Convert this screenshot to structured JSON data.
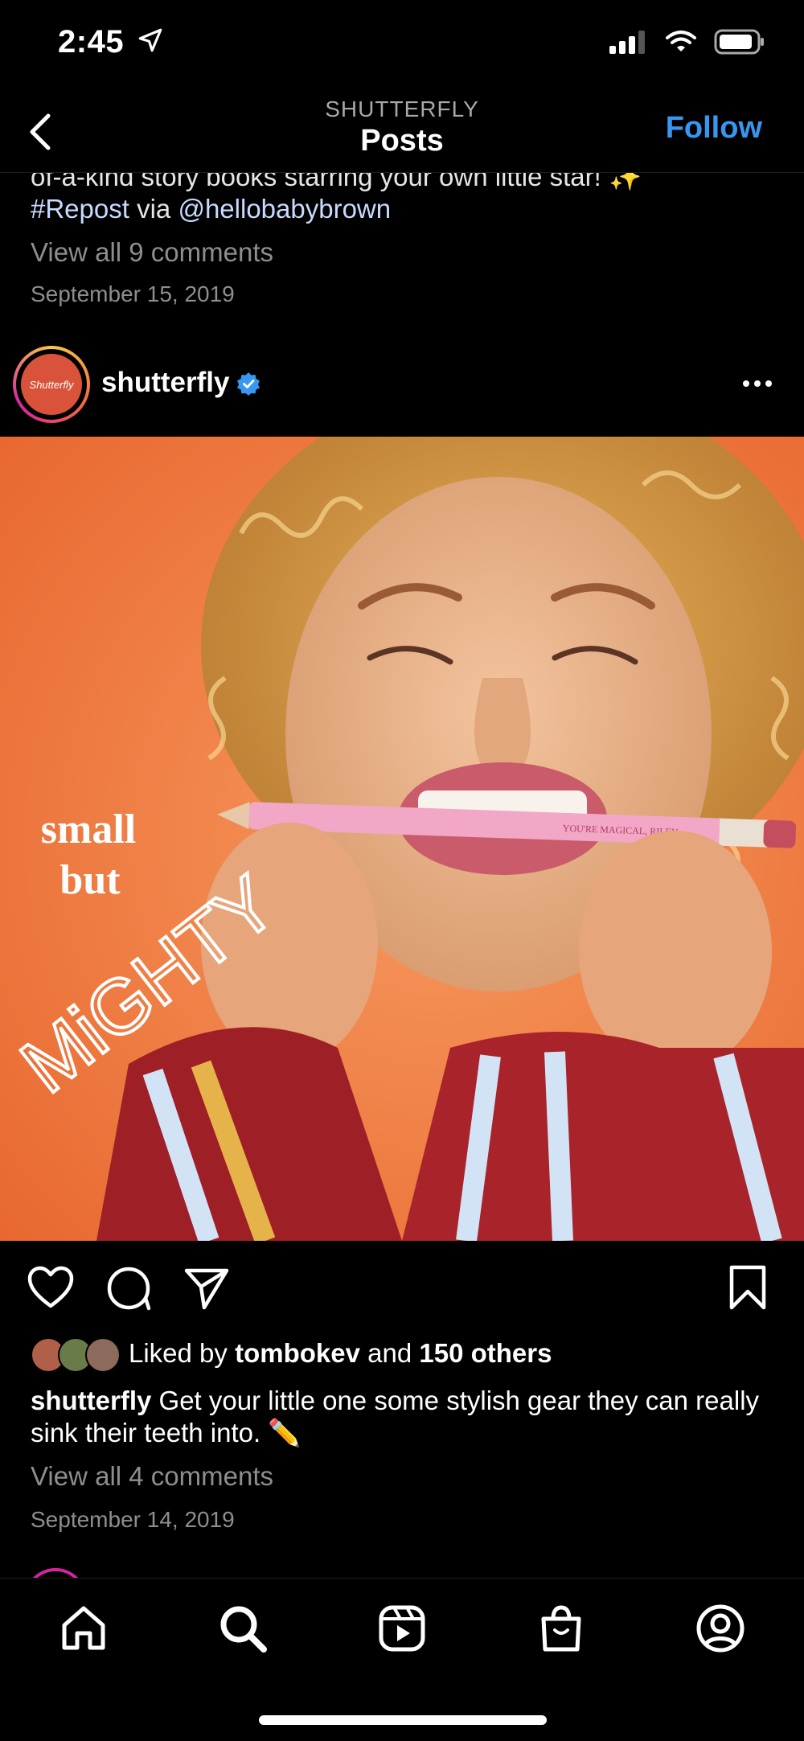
{
  "status_bar": {
    "time": "2:45"
  },
  "header": {
    "subtitle": "SHUTTERFLY",
    "title": "Posts",
    "follow_label": "Follow"
  },
  "previous_post": {
    "caption_partial": "of-a-kind story books starring your own little star! ✨",
    "hashtag": "#Repost",
    "via_text": " via ",
    "mention": "@hellobabybrown",
    "view_comments": "View all 9 comments",
    "date": "September 15, 2019"
  },
  "post": {
    "avatar_text": "Shutterfly",
    "username": "shutterfly",
    "image": {
      "overlay_line1": "small",
      "overlay_line2": "but",
      "overlay_line3": "MiGHTY",
      "pencil_text": "YOU'RE MAGICAL, RILEY"
    },
    "liked_by_prefix": "Liked by ",
    "liked_by_user": "tombokev",
    "liked_by_and": " and ",
    "liked_by_others": "150 others",
    "caption_user": "shutterfly",
    "caption_text": " Get your little one some stylish gear they can really sink their teeth into. ✏️",
    "view_comments": "View all 4 comments",
    "date": "September 14, 2019"
  },
  "nav": {
    "items": [
      "home-icon",
      "search-icon",
      "reels-icon",
      "shop-icon",
      "profile-icon"
    ]
  },
  "colors": {
    "accent": "#3797f0",
    "background": "#000000",
    "muted": "#8e8e8e"
  }
}
